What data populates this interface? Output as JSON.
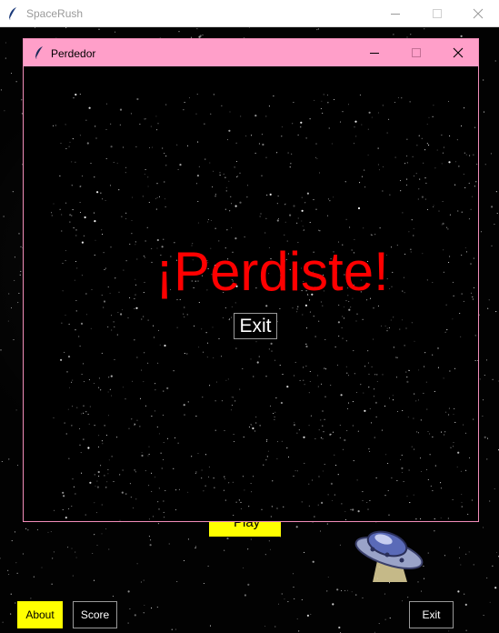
{
  "window": {
    "title": "SpaceRush",
    "controls": [
      "minimize",
      "maximize",
      "close"
    ]
  },
  "dialog": {
    "title": "Perdedor",
    "message": "¡Perdiste!",
    "exit_label": "Exit",
    "accent": "#ff9fc9",
    "message_color": "#ff0000"
  },
  "menu": {
    "play_label": "Play",
    "about_label": "About",
    "score_label": "Score",
    "exit_label": "Exit",
    "highlight_color": "#ffff00"
  },
  "icons": {
    "app": "feather-icon",
    "sprite": "ufo-icon"
  }
}
